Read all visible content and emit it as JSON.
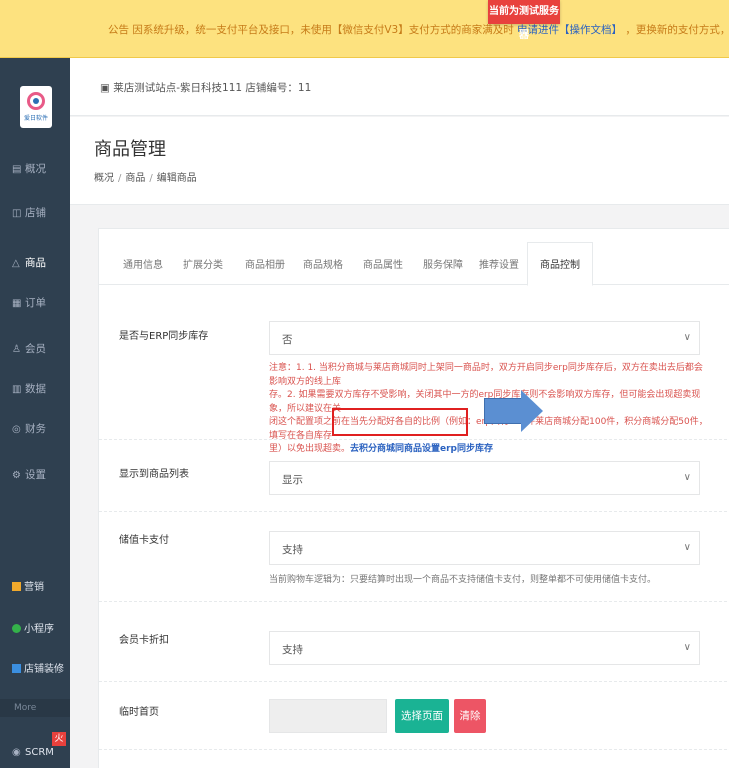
{
  "notice": {
    "text": "公告 因系统升级，统一支付平台及接口，未使用【微信支付V3】支付方式的商家满及时",
    "link": "申请进件【操作文档】",
    "text2": "，更换新的支付方式，以获得更好的支付体验，旧的支付方",
    "badge": "当前为测试服务器"
  },
  "logo_text": "爱日软件",
  "sidebar": {
    "items": [
      {
        "label": "概况",
        "icon": "概"
      },
      {
        "label": "店铺",
        "icon": "店"
      },
      {
        "label": "商品",
        "icon": "商"
      },
      {
        "label": "订单",
        "icon": "订"
      },
      {
        "label": "会员",
        "icon": "会"
      },
      {
        "label": "数据",
        "icon": "数"
      },
      {
        "label": "财务",
        "icon": "财"
      },
      {
        "label": "设置",
        "icon": "设"
      }
    ],
    "extras": [
      {
        "label": "营销",
        "color": "#f0a92c"
      },
      {
        "label": "小程序",
        "color": "#34b24a"
      },
      {
        "label": "店铺装修",
        "color": "#3b8fe0"
      }
    ],
    "more": "More",
    "scrm": "SCRM",
    "scrm_badge": "火"
  },
  "store_info": "莱店测试站点-紫日科技111   店铺编号：11",
  "page_title": "商品管理",
  "breadcrumb": [
    "概况",
    "商品",
    "编辑商品"
  ],
  "tabs": [
    "通用信息",
    "扩展分类",
    "商品相册",
    "商品规格",
    "商品属性",
    "服务保障",
    "推荐设置",
    "商品控制"
  ],
  "form": {
    "erp": {
      "label": "是否与ERP同步库存",
      "value": "否",
      "hint_line1": "注意：1. 1. 当积分商城与莱店商城同时上架同一商品时，双方开启同步erp同步库存后，双方在卖出去后都会影响双方的线上库",
      "hint_line2": "存。2. 如果需要双方库存不受影响，关闭其中一方的erp同步库存则不会影响双方库存，但可能会出现超卖现象，所以建议在关",
      "hint_line3": "闭这个配置项之前在当先分配好各自的比例（例如：erp共有150件莱店商城分配100件，积分商城分配50件，填写在各自库存",
      "hint_line4": "里）以免出现超卖。",
      "hint_link": "去积分商城同商品设置erp同步库存"
    },
    "show_list": {
      "label": "显示到商品列表",
      "value": "显示"
    },
    "stored_card": {
      "label": "储值卡支付",
      "value": "支持",
      "hint": "当前购物车逻辑为：只要结算时出现一个商品不支持储值卡支付，则整单都不可使用储值卡支付。"
    },
    "member_discount": {
      "label": "会员卡折扣",
      "value": "支持"
    },
    "temp_home": {
      "label": "临时首页",
      "select_btn": "选择页面",
      "clear_btn": "清除"
    }
  }
}
